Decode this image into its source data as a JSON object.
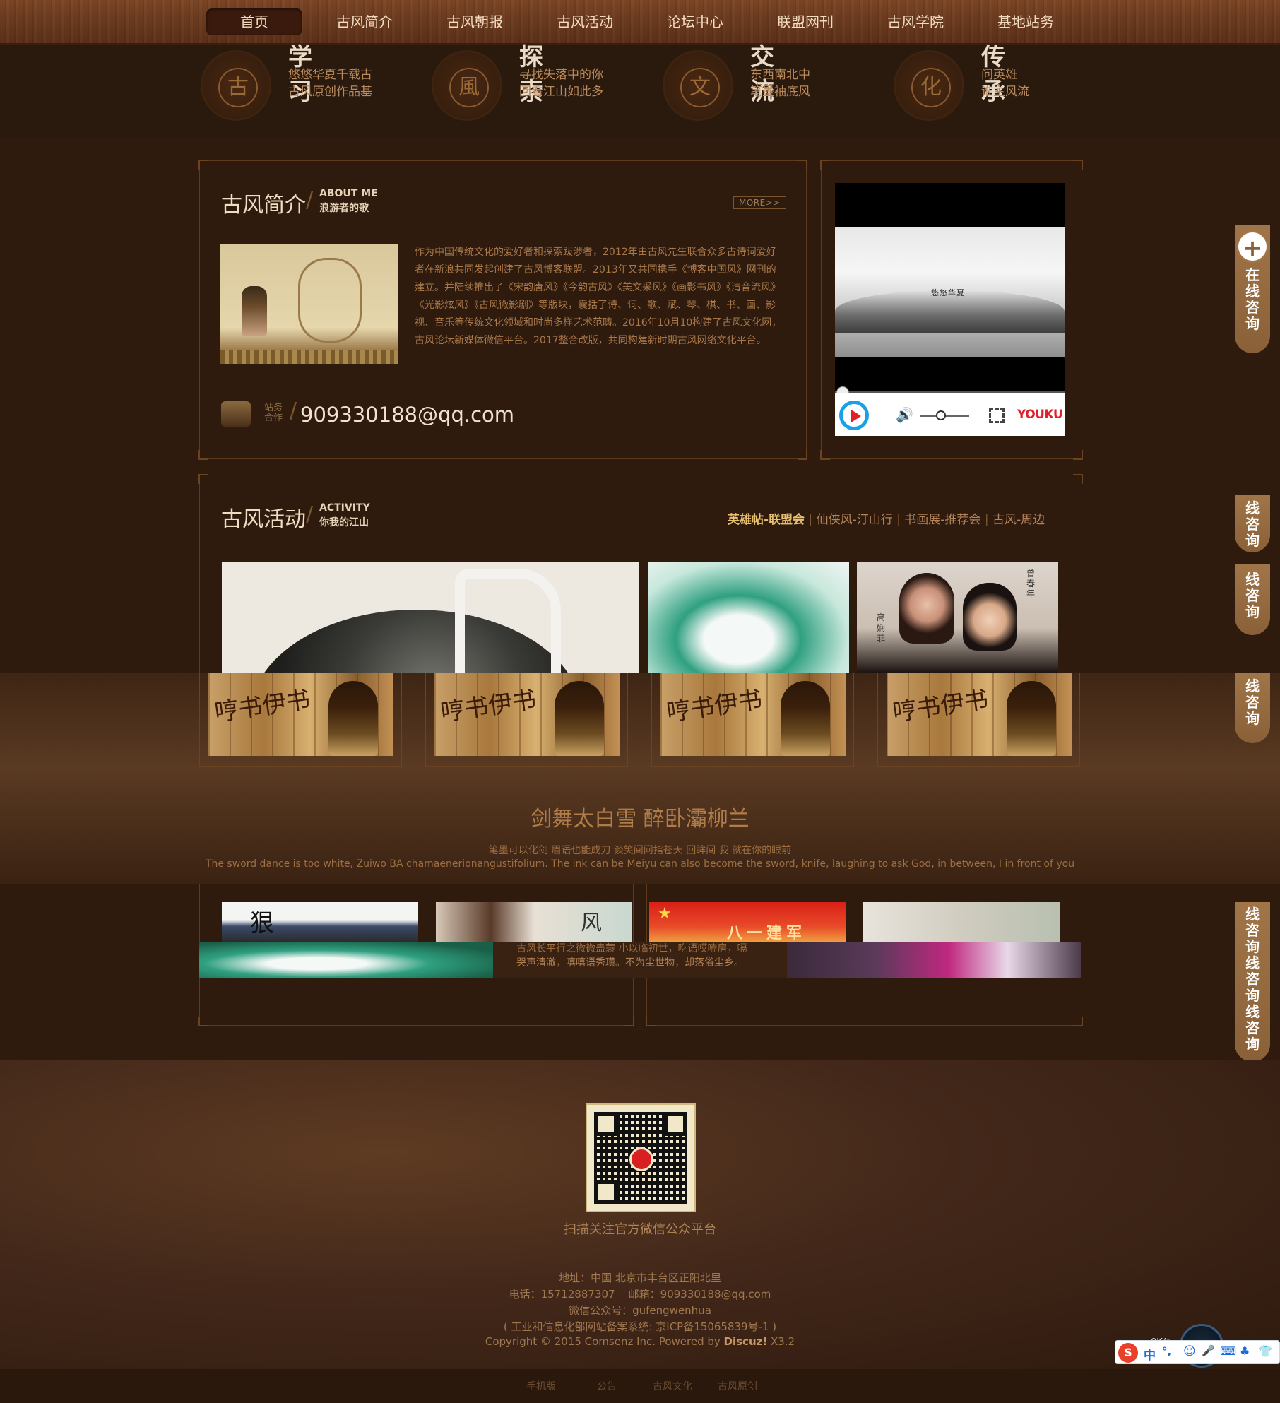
{
  "nav": {
    "items": [
      "首页",
      "古风简介",
      "古风朝报",
      "古风活动",
      "论坛中心",
      "联盟网刊",
      "古风学院",
      "基地站务"
    ],
    "active": "首页"
  },
  "features": [
    {
      "glyph": "古",
      "title": "学习",
      "line1": "悠悠华夏千载古",
      "line2": "古风原创作品基"
    },
    {
      "glyph": "風",
      "title": "探索",
      "line1": "寻找失落中的你",
      "line2": "回看江山如此多"
    },
    {
      "glyph": "文",
      "title": "交流",
      "line1": "东西南北中",
      "line2": "笔墨袖底风"
    },
    {
      "glyph": "化",
      "title": "传承",
      "line1": "问英雄",
      "line2": "谁主风流"
    }
  ],
  "about": {
    "title": "古风简介",
    "sub_en": "ABOUT ME",
    "sub_cn": "浪游者的歌",
    "more": "MORE>>",
    "text": "作为中国传统文化的爱好者和探索跋涉者，2012年由古风先生联合众多古诗词爱好者在新浪共同发起创建了古风博客联盟。2013年又共同携手《博客中国风》网刊的建立。并陆续推出了《宋韵唐风》《今韵古风》《美文采风》《画影书风》《清音流风》《光影炫风》《古风微影剧》等版块，囊括了诗、词、歌、赋、琴、棋、书、画、影视、音乐等传统文化领域和时尚多样艺术范畴。2016年10月10构建了古风文化网，古风论坛新媒体微信平台。2017整合改版，共同构建新时期古风网络文化平台。",
    "contact_label_1": "站务",
    "contact_label_2": "合作",
    "email": "909330188@qq.com"
  },
  "video": {
    "overlay_text": "悠悠华夏",
    "brand": "YOUKU"
  },
  "activity": {
    "title": "古风活动",
    "sub_en": "ACTIVITY",
    "sub_cn": "你我的江山",
    "links": [
      "英雄帖-联盟会",
      "仙侠风-汀山行",
      "书画展-推荐会",
      "古风-周边"
    ],
    "separator": "|",
    "poster_names": [
      "高",
      "娴",
      "菲"
    ],
    "poster_names2": [
      "曾",
      "春",
      "年"
    ]
  },
  "thumbs": {
    "caption": "哼书伊书"
  },
  "banner": {
    "title": "剑舞太白雪 醉卧灞柳兰",
    "line_cn": "笔墨可以化剑 眉语也能成刀 谈笑间问指苍天 回眸间 我 就在你的眼前",
    "line_en": "The sword dance is too white, Zuiwo BA chamaenerionangustifolium. The ink can be Meiyu can also become the sword, knife, laughing to ask God, in between, I in front of you"
  },
  "lower": {
    "card_text_1": "古风长平行之微微蛊蓑 小以临初世，吃语哎嗑房，嗝",
    "card_text_2": "哭声清澈，嘻嘻语秀璜。不为尘世物，却落俗尘乡。",
    "poster_text": "八一建军",
    "calligraphy": "风",
    "calligraphy2": "狠"
  },
  "side": {
    "plus": "+",
    "label": "在线咨询",
    "label_short": "线咨询"
  },
  "footer": {
    "qr_caption": "扫描关注官方微信公众平台",
    "address": "地址：中国 北京市丰台区正阳北里",
    "phone_line": "电话：15712887307    邮箱：909330188@qq.com",
    "wechat": "微信公众号：gufengwenhua",
    "icp": "( 工业和信息化部网站备案系统: 京ICP备15065839号-1 )",
    "copyright_prefix": "Copyright © 2015 Comsenz Inc. Powered by ",
    "copyright_brand": "Discuz!",
    "copyright_ver": " X3.2",
    "bottom_links": [
      "手机版",
      "公告",
      "古风文化",
      "古风原创"
    ]
  },
  "ime": {
    "items": [
      "S",
      "中",
      "°,",
      "☺",
      "🎤",
      "⌨",
      "♣",
      "👕"
    ],
    "speed": "0K/s"
  },
  "colors": {
    "accent": "#c9a070",
    "nav": "#6a3a1e",
    "bg": "#2e1b0e"
  }
}
